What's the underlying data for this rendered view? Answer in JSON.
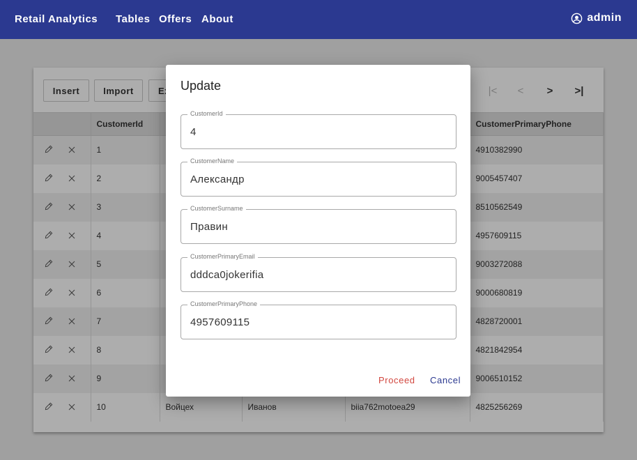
{
  "navbar": {
    "brand": "Retail Analytics",
    "links": [
      "Tables",
      "Offers",
      "About"
    ],
    "user": "admin",
    "user_icon": "account-circle-icon",
    "bg_color": "#2b3990"
  },
  "toolbar": {
    "insert_label": "Insert",
    "import_label": "Import",
    "export_label": "Ex",
    "pager": [
      "|<",
      "<",
      ">",
      ">|"
    ]
  },
  "table": {
    "columns": [
      "",
      "CustomerId",
      "C",
      "",
      "",
      "CustomerPrimaryPhone"
    ],
    "rows": [
      {
        "id": "1",
        "name": "",
        "surname": "",
        "email": "",
        "phone": "4910382990"
      },
      {
        "id": "2",
        "name": "",
        "surname": "",
        "email": "",
        "phone": "9005457407"
      },
      {
        "id": "3",
        "name": "",
        "surname": "",
        "email": "",
        "phone": "8510562549"
      },
      {
        "id": "4",
        "name": "",
        "surname": "",
        "email": "",
        "phone": "4957609115"
      },
      {
        "id": "5",
        "name": "",
        "surname": "",
        "email": "",
        "phone": "9003272088"
      },
      {
        "id": "6",
        "name": "",
        "surname": "",
        "email": "",
        "phone": "9000680819"
      },
      {
        "id": "7",
        "name": "",
        "surname": "",
        "email": "",
        "phone": "4828720001"
      },
      {
        "id": "8",
        "name": "",
        "surname": "",
        "email": "",
        "phone": "4821842954"
      },
      {
        "id": "9",
        "name": "",
        "surname": "",
        "email": "",
        "phone": "9006510152"
      },
      {
        "id": "10",
        "name": "Войцех",
        "surname": "Иванов",
        "email": "biia762motoea29",
        "phone": "4825256269"
      }
    ]
  },
  "dialog": {
    "title": "Update",
    "fields": [
      {
        "label": "CustomerId",
        "value": "4"
      },
      {
        "label": "CustomerName",
        "value": "Александр"
      },
      {
        "label": "CustomerSurname",
        "value": "Правин"
      },
      {
        "label": "CustomerPrimaryEmail",
        "value": "dddca0jokerifia"
      },
      {
        "label": "CustomerPrimaryPhone",
        "value": "4957609115"
      }
    ],
    "proceed_label": "Proceed",
    "cancel_label": "Cancel",
    "proceed_color": "#d2473f",
    "cancel_color": "#2b3990"
  }
}
